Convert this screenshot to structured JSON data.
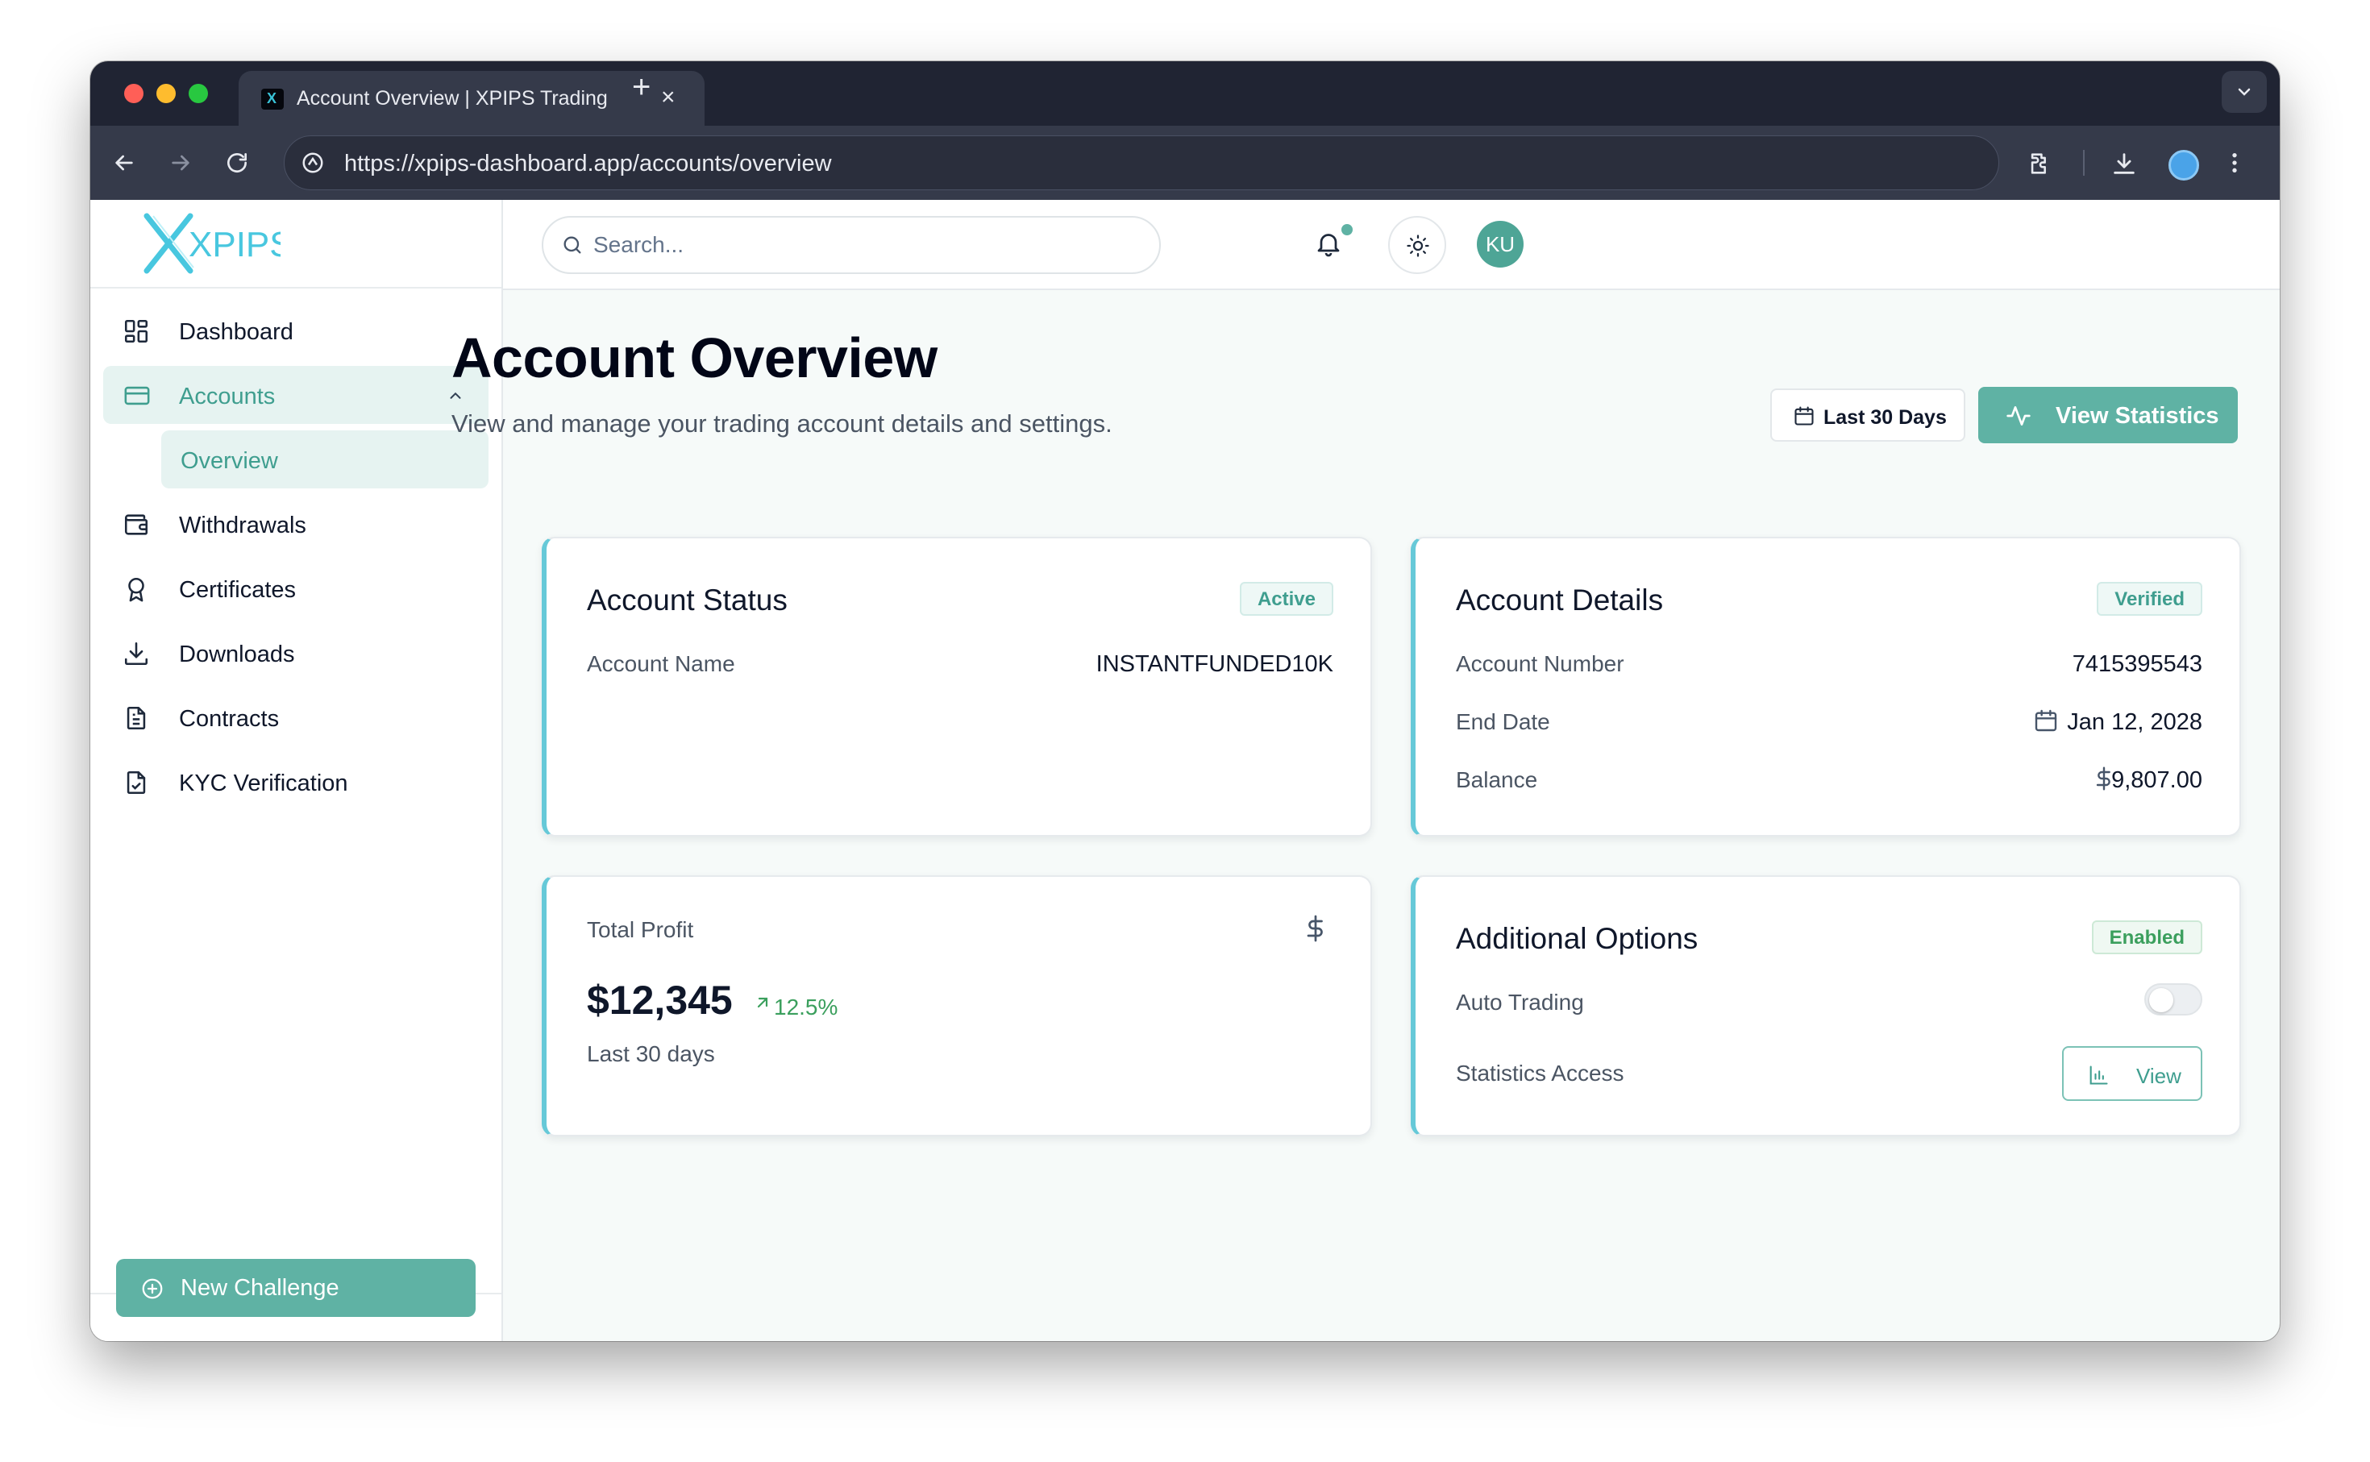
{
  "browser": {
    "tab_title": "Account Overview | XPIPS Trading",
    "url": "https://xpips-dashboard.app/accounts/overview"
  },
  "brand": {
    "logo_text": "XPIPS",
    "accent_color": "#5fb2a4",
    "card_border_color": "#66c9d8"
  },
  "sidebar": {
    "items": [
      {
        "label": "Dashboard",
        "icon": "dashboard-icon"
      },
      {
        "label": "Accounts",
        "icon": "card-icon",
        "active": true,
        "expanded": true
      },
      {
        "label": "Withdrawals",
        "icon": "wallet-icon"
      },
      {
        "label": "Certificates",
        "icon": "award-icon"
      },
      {
        "label": "Downloads",
        "icon": "download-icon"
      },
      {
        "label": "Contracts",
        "icon": "file-text-icon"
      },
      {
        "label": "KYC Verification",
        "icon": "file-check-icon"
      }
    ],
    "sub_items": [
      {
        "label": "Overview",
        "active": true
      }
    ],
    "new_challenge_label": "New Challenge"
  },
  "header": {
    "search_placeholder": "Search...",
    "avatar_initials": "KU",
    "has_notifications": true
  },
  "page": {
    "title": "Account Overview",
    "subtitle": "View and manage your trading account details and settings.",
    "date_range_label": "Last 30 Days",
    "view_statistics_label": "View Statistics"
  },
  "cards": {
    "account_status": {
      "title": "Account Status",
      "badge": "Active",
      "account_name_label": "Account Name",
      "account_name_value": "INSTANTFUNDED10K"
    },
    "account_details": {
      "title": "Account Details",
      "badge": "Verified",
      "account_number_label": "Account Number",
      "account_number_value": "7415395543",
      "end_date_label": "End Date",
      "end_date_value": "Jan 12, 2028",
      "balance_label": "Balance",
      "balance_value": "9,807.00"
    },
    "total_profit": {
      "title": "Total Profit",
      "value": "$12,345",
      "change": "12.5%",
      "period": "Last 30 days"
    },
    "additional_options": {
      "title": "Additional Options",
      "badge": "Enabled",
      "auto_trading_label": "Auto Trading",
      "auto_trading_enabled": false,
      "statistics_access_label": "Statistics Access",
      "view_label": "View"
    }
  }
}
